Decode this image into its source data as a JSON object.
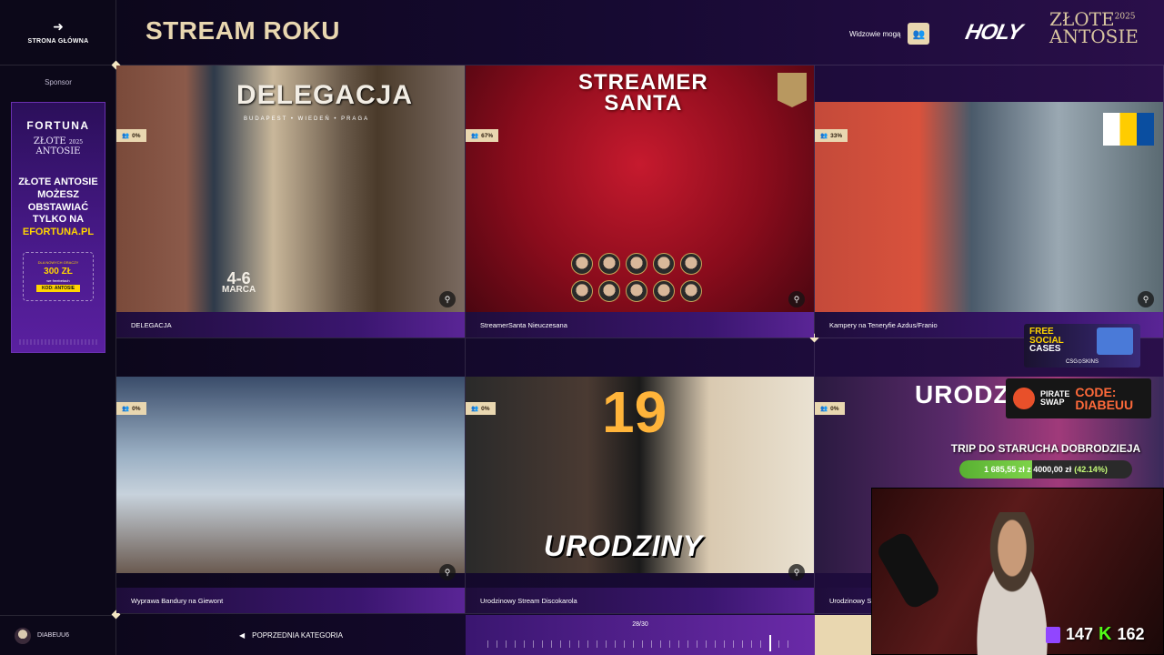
{
  "nav": {
    "home_label": "STRONA GŁÓWNA",
    "home_icon": "arrow-left-icon"
  },
  "header": {
    "title": "STREAM ROKU",
    "viewers_label": "Widzowie mogą",
    "viewers_icon": "users-icon",
    "logo_holy": "HOLY",
    "logo_zlote_line1": "ZŁOTE",
    "logo_zlote_year": "2025",
    "logo_zlote_line2": "ANTOSIE"
  },
  "sponsor": {
    "label": "Sponsor",
    "brand": "FORTUNA",
    "event_line1": "ZŁOTE",
    "event_year": "2025",
    "event_line2": "ANTOSIE",
    "claim_lines": [
      "ZŁOTE ANTOSIE",
      "MOŻESZ",
      "OBSTAWIAĆ",
      "TYLKO NA"
    ],
    "claim_highlight": "EFORTUNA.PL",
    "bonus_small": "DLA NOWYCH GRACZY",
    "bonus_amount": "300 ZŁ",
    "bonus_sub": "we freebetach",
    "bonus_code": "KOD: ANTOSIE"
  },
  "nominees": [
    {
      "title": "DELEGACJA",
      "percent": "0%",
      "poster": {
        "headline": "DELEGACJA",
        "cities": "BUDAPEST • WIEDEŃ • PRAGA",
        "date_line1": "4-6",
        "date_line2": "MARCA"
      }
    },
    {
      "title": "StreamerSanta Nieuczesana",
      "percent": "67%",
      "poster": {
        "headline_line1": "STREAMER",
        "headline_line2": "SANTA"
      }
    },
    {
      "title": "Kampery na Teneryfie Azdus/Franio",
      "percent": "33%"
    },
    {
      "title": "Wyprawa Bandury na Giewont",
      "percent": "0%"
    },
    {
      "title": "Urodzinowy Stream Discokarola",
      "percent": "0%",
      "poster": {
        "headline": "URODZINY",
        "number": "19"
      }
    },
    {
      "title": "Urodzinowy St",
      "percent": "0%",
      "poster": {
        "headline": "URODZ"
      }
    }
  ],
  "footer": {
    "prev_label": "POPRZEDNIA KATEGORIA",
    "prev_icon": "arrow-left-icon",
    "page_counter": "28/30",
    "progress_fraction": 0.93
  },
  "user": {
    "name": "DIABEUU6"
  },
  "overlays": {
    "csg_line1": "FREE",
    "csg_line2": "SOCIAL",
    "csg_line3": "CASES",
    "csg_brand": "CSG⊙SKINS",
    "pirate_line1": "PIRATE",
    "pirate_line2": "SWAP",
    "pirate_code_line1": "CODE:",
    "pirate_code_line2": "DIABEUU",
    "goal_title": "TRIP DO STARUCHA DOBRODZIEJA",
    "goal_current": "1 685,55 zł",
    "goal_separator": "z",
    "goal_target": "4000,00 zł",
    "goal_percent_label": "(42.14%)",
    "goal_fraction": 0.4214,
    "twitch_count": "147",
    "kick_count": "162",
    "kick_letter": "K"
  }
}
